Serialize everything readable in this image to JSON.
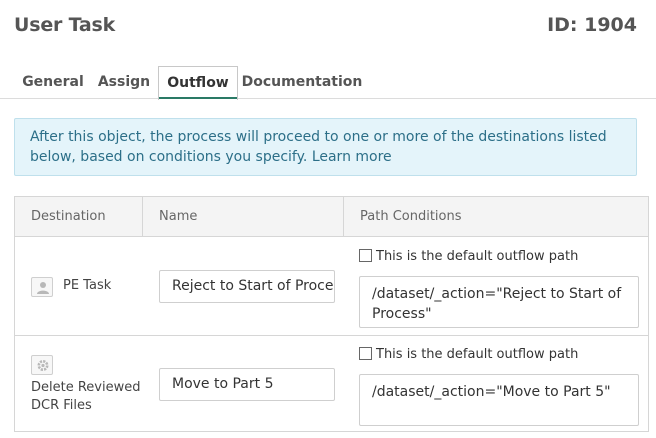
{
  "header": {
    "title": "User Task",
    "id_label": "ID: 1904"
  },
  "tabs": [
    {
      "label": "General",
      "active": false
    },
    {
      "label": "Assign",
      "active": false
    },
    {
      "label": "Outflow",
      "active": true
    },
    {
      "label": "Documentation",
      "active": false
    }
  ],
  "info": {
    "text": "After this object, the process will proceed to one or more of the destinations listed below, based on conditions you specify. ",
    "link": "Learn more"
  },
  "table": {
    "columns": [
      "Destination",
      "Name",
      "Path Conditions"
    ],
    "rows": [
      {
        "destination_icon": "user-icon",
        "destination": "PE Task",
        "name": "Reject to Start of Proce",
        "default_label": "This is the default outflow path",
        "default_checked": false,
        "condition": "/dataset/_action=\"Reject to Start of Process\""
      },
      {
        "destination_icon": "gear-icon",
        "destination": "Delete Reviewed DCR Files",
        "name": "Move to Part 5",
        "default_label": "This is the default outflow path",
        "default_checked": false,
        "condition": "/dataset/_action=\"Move to Part 5\""
      }
    ]
  },
  "colors": {
    "info_bg": "#e4f4fa",
    "info_text": "#2c6f88",
    "tab_active_underline": "#2a7a66"
  }
}
